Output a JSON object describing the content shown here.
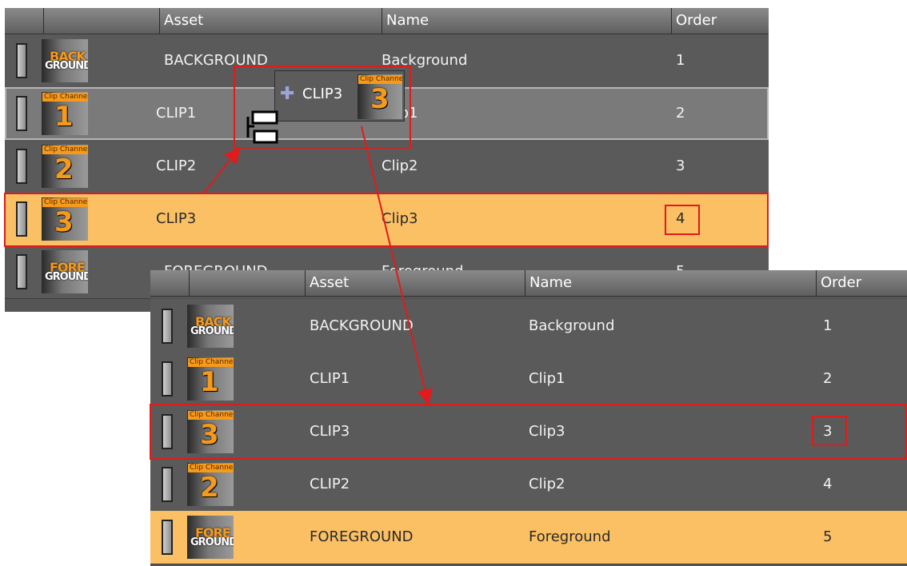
{
  "columns": {
    "asset": "Asset",
    "name": "Name",
    "order": "Order"
  },
  "before": {
    "rows": [
      {
        "thumb": "background",
        "asset": "BACKGROUND",
        "name": "Background",
        "order": "1"
      },
      {
        "thumb": "clip",
        "tag": "Clip Channel",
        "num": "1",
        "asset": "CLIP1",
        "name": "Clip1",
        "order": "2"
      },
      {
        "thumb": "clip",
        "tag": "Clip Channel",
        "num": "2",
        "asset": "CLIP2",
        "name": "Clip2",
        "order": "3"
      },
      {
        "thumb": "clip",
        "tag": "Clip Channel",
        "num": "3",
        "asset": "CLIP3",
        "name": "Clip3",
        "order": "4"
      },
      {
        "thumb": "foreground",
        "asset": "FOREGROUND",
        "name": "Foreground",
        "order": "5"
      }
    ]
  },
  "after": {
    "rows": [
      {
        "thumb": "background",
        "asset": "BACKGROUND",
        "name": "Background",
        "order": "1"
      },
      {
        "thumb": "clip",
        "tag": "Clip Channel",
        "num": "1",
        "asset": "CLIP1",
        "name": "Clip1",
        "order": "2"
      },
      {
        "thumb": "clip",
        "tag": "Clip Channel",
        "num": "3",
        "asset": "CLIP3",
        "name": "Clip3",
        "order": "3"
      },
      {
        "thumb": "clip",
        "tag": "Clip Channel",
        "num": "2",
        "asset": "CLIP2",
        "name": "Clip2",
        "order": "4"
      },
      {
        "thumb": "foreground",
        "asset": "FOREGROUND",
        "name": "Foreground",
        "order": "5"
      }
    ]
  },
  "thumbs": {
    "back_top": "BACK",
    "back_bottom": "GROUND",
    "fore_top": "FORE",
    "fore_bottom": "GROUND"
  },
  "drag_ghost": {
    "label": "CLIP3",
    "tag": "Clip Channel",
    "num": "3"
  },
  "colors": {
    "highlight": "#fbc064",
    "annotation": "#e01b1b",
    "panel": "#555555",
    "accent": "#f59a1b"
  }
}
